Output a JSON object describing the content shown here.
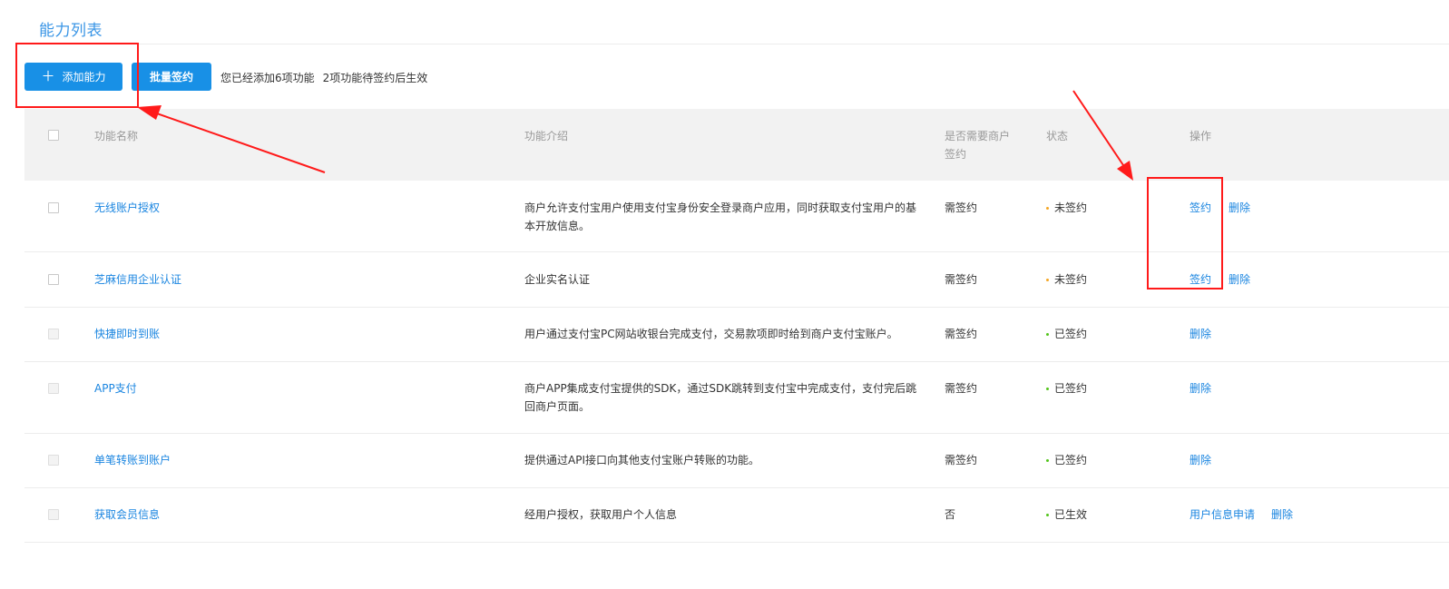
{
  "page": {
    "title": "能力列表"
  },
  "toolbar": {
    "add_label": "添加能力",
    "batch_label": "批量签约",
    "summary_added": "您已经添加6项功能",
    "summary_pending": "2项功能待签约后生效"
  },
  "table": {
    "headers": {
      "name": "功能名称",
      "desc": "功能介绍",
      "need_sign_line1": "是否需要商户",
      "need_sign_line2": "签约",
      "status": "状态",
      "ops": "操作"
    },
    "rows": [
      {
        "name": "无线账户授权",
        "desc_line1": "商户允许支付宝用户使用支付宝身份安全登录商户应用，同时获取支付宝用户的基",
        "desc_line2": "本开放信息。",
        "sign": "需签约",
        "status": "未签约",
        "status_color": "#f5a623",
        "op1": "签约",
        "op2": "删除"
      },
      {
        "name": "芝麻信用企业认证",
        "desc_line1": "企业实名认证",
        "sign": "需签约",
        "status": "未签约",
        "status_color": "#f5a623",
        "op1": "签约",
        "op2": "删除"
      },
      {
        "name": "快捷即时到账",
        "desc_line1": "用户通过支付宝PC网站收银台完成支付，交易款项即时给到商户支付宝账户。",
        "sign": "需签约",
        "status": "已签约",
        "status_color": "#52c41a",
        "op1": "删除"
      },
      {
        "name": "APP支付",
        "desc_line1": "商户APP集成支付宝提供的SDK，通过SDK跳转到支付宝中完成支付，支付完后跳",
        "desc_line2": "回商户页面。",
        "sign": "需签约",
        "status": "已签约",
        "status_color": "#52c41a",
        "op1": "删除"
      },
      {
        "name": "单笔转账到账户",
        "desc_line1": "提供通过API接口向其他支付宝账户转账的功能。",
        "sign": "需签约",
        "status": "已签约",
        "status_color": "#52c41a",
        "op1": "删除"
      },
      {
        "name": "获取会员信息",
        "desc_line1": "经用户授权，获取用户个人信息",
        "sign": "否",
        "status": "已生效",
        "status_color": "#52c41a",
        "op1": "用户信息申请",
        "op2": "删除"
      }
    ]
  },
  "colors": {
    "accent": "#1890e6",
    "link": "#1a85e0",
    "annotation": "#ff1a1a"
  }
}
